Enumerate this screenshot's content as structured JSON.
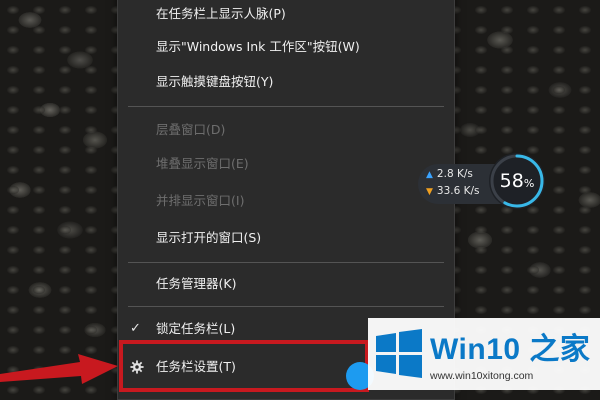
{
  "menu": {
    "items": [
      {
        "label": "在任务栏上显示人脉(P)",
        "disabled": false
      },
      {
        "label": "显示\"Windows Ink 工作区\"按钮(W)",
        "disabled": false
      },
      {
        "label": "显示触摸键盘按钮(Y)",
        "disabled": false
      },
      {
        "label": "层叠窗口(D)",
        "disabled": true
      },
      {
        "label": "堆叠显示窗口(E)",
        "disabled": true
      },
      {
        "label": "并排显示窗口(I)",
        "disabled": true
      },
      {
        "label": "显示打开的窗口(S)",
        "disabled": false
      },
      {
        "label": "任务管理器(K)",
        "disabled": false
      },
      {
        "label": "锁定任务栏(L)",
        "disabled": false,
        "checked": true
      },
      {
        "label": "任务栏设置(T)",
        "disabled": false,
        "icon": "gear-icon"
      }
    ]
  },
  "network": {
    "upload": "2.8 K/s",
    "download": "33.6 K/s",
    "usage_value": "58",
    "usage_unit": "%",
    "usage_fraction": 0.58
  },
  "watermark": {
    "brand": "Win10 之家",
    "url": "www.win10xitong.com"
  },
  "colors": {
    "menu_bg": "#2b2b2b",
    "highlight": "#c8191f",
    "brand_blue": "#0b79c7",
    "upload_arrow": "#3aa3ff",
    "download_arrow": "#f0a020"
  }
}
